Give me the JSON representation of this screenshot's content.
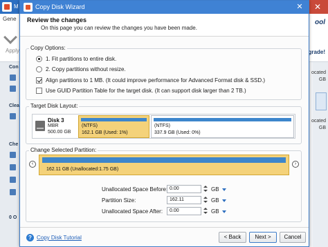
{
  "background_app": {
    "title": "M",
    "tab_general": "Gene",
    "apply_label": "Apply",
    "brand_fragment": "ool",
    "upgrade_fragment": "grade!",
    "left_labels": [
      "Con",
      "Clea",
      "Che"
    ],
    "status_fragment": "0 O",
    "right_labels": [
      "ocated",
      "GB",
      "ocated",
      "GB"
    ]
  },
  "dialog": {
    "title": "Copy Disk Wizard",
    "close_glyph": "✕",
    "header": {
      "title": "Review the changes",
      "subtitle": "On this page you can review the changes you have been made."
    },
    "copy_options": {
      "title": "Copy Options:",
      "options": [
        {
          "label": "1. Fit partitions to entire disk.",
          "type": "radio",
          "checked": true
        },
        {
          "label": "2. Copy partitions without resize.",
          "type": "radio",
          "checked": false
        },
        {
          "label": "Align partitions to 1 MB.  (It could improve performance for Advanced Format disk & SSD.)",
          "type": "checkbox",
          "checked": true
        },
        {
          "label": "Use GUID Partition Table for the target disk. (It can support disk larger than 2 TB.)",
          "type": "checkbox",
          "checked": false
        }
      ]
    },
    "target_disk_layout": {
      "title": "Target Disk Layout:",
      "disk": {
        "name": "Disk 3",
        "type": "MBR",
        "size": "500.00 GB"
      },
      "partitions": [
        {
          "fs": "(NTFS)",
          "usage": "162.1 GB (Used: 1%)",
          "selected": true,
          "bar_fill": 0.99
        },
        {
          "fs": "(NTFS)",
          "usage": "337.9 GB (Used: 0%)",
          "selected": false,
          "bar_fill": 0.99
        }
      ]
    },
    "change_partition": {
      "title": "Change Selected Partition:",
      "bar_label": "162.11 GB (Unallocated:1.75 GB)",
      "left_arrow": "‹",
      "right_arrow": "›",
      "fields": [
        {
          "label": "Unallocated Space Before:",
          "value": "0.00",
          "unit": "GB"
        },
        {
          "label": "Partition Size:",
          "value": "162.11",
          "unit": "GB"
        },
        {
          "label": "Unallocated Space After:",
          "value": "0.00",
          "unit": "GB"
        }
      ]
    },
    "footer": {
      "help_glyph": "?",
      "tutorial_link": "Copy Disk Tutorial",
      "back_label": "< Back",
      "next_label": "Next >",
      "cancel_label": "Cancel"
    }
  },
  "colors": {
    "titlebar": "#3f82d4",
    "selected_partition": "#f4d27a",
    "partition_bar": "#3d86cc",
    "link": "#1f5fb8"
  }
}
